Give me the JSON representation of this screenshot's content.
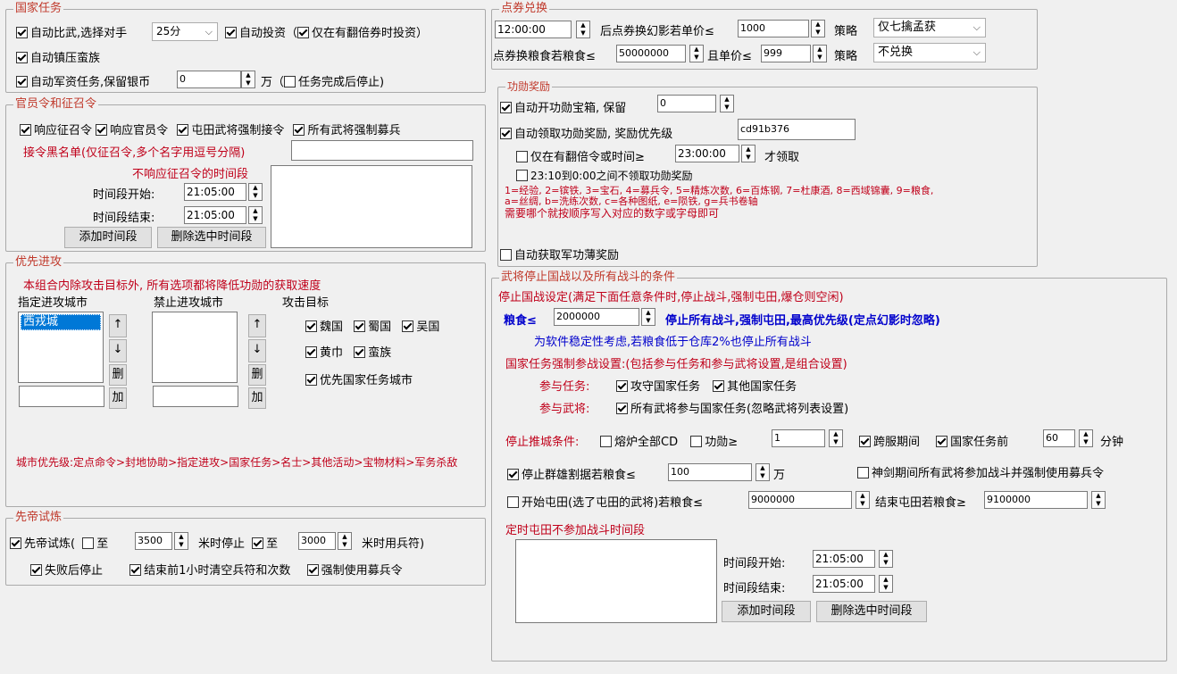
{
  "national_tasks": {
    "title": "国家任务",
    "auto_duel": "自动比武,选择对手",
    "opponent": "25分",
    "auto_invest": "自动投资（",
    "invest_only_double": "仅在有翻倍券时投资",
    "invest_close": "）",
    "auto_suppress": "自动镇压蛮族",
    "auto_military": "自动军资任务,保留银币",
    "silver_value": "0",
    "unit_wan": "万（",
    "stop_after_task": "任务完成后停止)"
  },
  "coupon_exchange": {
    "title": "点券兑换",
    "time_value": "12:00:00",
    "exchange_phantom": "后点券换幻影若单价≤",
    "phantom_price": "1000",
    "strategy_label": "策略",
    "strategy1": "仅七擒孟获",
    "exchange_food": "点券换粮食若粮食≤",
    "food_value": "50000000",
    "and_price": "且单价≤",
    "food_price": "999",
    "strategy2": "不兑换"
  },
  "officer_orders": {
    "title": "官员令和征召令",
    "respond_conscript": "响应征召令",
    "respond_officer": "响应官员令",
    "farm_force": "屯田武将强制接令",
    "all_force_recruit": "所有武将强制募兵",
    "blacklist_label": "接令黑名单(仅征召令,多个名字用逗号分隔)",
    "no_respond_period": "不响应征召令的时间段",
    "period_start_label": "时间段开始:",
    "period_start": "21:05:00",
    "period_end_label": "时间段结束:",
    "period_end": "21:05:00",
    "add_period": "添加时间段",
    "delete_period": "删除选中时间段"
  },
  "priority_attack": {
    "title": "优先进攻",
    "note": "本组合内除攻击目标外, 所有选项都将降低功勋的获取速度",
    "assigned_label": "指定进攻城市",
    "forbidden_label": "禁止进攻城市",
    "target_label": "攻击目标",
    "assigned_city": "西戎城",
    "up": "↑",
    "down": "↓",
    "delete": "删",
    "add": "加",
    "wei": "魏国",
    "shu": "蜀国",
    "wu": "吴国",
    "huangjin": "黄巾",
    "manzu": "蛮族",
    "priority_national": "优先国家任务城市",
    "city_priority": "城市优先级:定点命令>封地协助>指定进攻>国家任务>名士>其他活动>宝物材料>军务杀敌"
  },
  "merit_rewards": {
    "title": "功勋奖励",
    "auto_open_chest": "自动开功勋宝箱, 保留",
    "keep_value": "0",
    "auto_claim": "自动领取功勋奖励, 奖励优先级",
    "priority_value": "cd91b376",
    "only_double": "仅在有翻倍令或时间≥",
    "claim_time": "23:00:00",
    "claim_suffix": "才领取",
    "no_claim_range": "23:10到0:00之间不领取功勋奖励",
    "legend1": "1=经验, 2=镔铁, 3=宝石, 4=募兵令, 5=精炼次数, 6=百炼钢, 7=杜康酒, 8=西域锦囊, 9=粮食,",
    "legend2": "a=丝绸, b=洗练次数, c=各种图纸, e=陨铁, g=兵书卷轴",
    "legend3": "需要哪个就按顺序写入对应的数字或字母即可",
    "auto_military_book": "自动获取军功薄奖励"
  },
  "stop_conditions": {
    "title": "武将停止国战以及所有战斗的条件",
    "stop_setting": "停止国战设定(满足下面任意条件时,停止战斗,强制屯田,爆仓则空闲)",
    "food_label": "粮食≤",
    "food_value": "2000000",
    "food_desc": "停止所有战斗,强制屯田,最高优先级(定点幻影时忽略)",
    "stability_note": "为软件稳定性考虑,若粮食低于仓库2%也停止所有战斗",
    "national_force": "国家任务强制参战设置:(包括参与任务和参与武将设置,是组合设置)",
    "join_task_label": "参与任务:",
    "attack_defend": "攻守国家任务",
    "other_national": "其他国家任务",
    "join_general_label": "参与武将:",
    "all_generals": "所有武将参与国家任务(忽略武将列表设置)",
    "push_stop_label": "停止推城条件:",
    "furnace_cd": "熔炉全部CD",
    "merit_ge": "功勋≥",
    "merit_value": "1",
    "cross_server": "跨服期间",
    "before_national": "国家任务前",
    "before_value": "60",
    "minutes": "分钟",
    "stop_chaos": "停止群雄割据若粮食≤",
    "chaos_value": "100",
    "wan": "万",
    "divine_sword": "神剑期间所有武将参加战斗并强制使用募兵令",
    "start_farm": "开始屯田(选了屯田的武将)若粮食≤",
    "start_farm_value": "9000000",
    "end_farm": "结束屯田若粮食≥",
    "end_farm_value": "9100000",
    "timed_farm": "定时屯田不参加战斗时间段",
    "period_start_label": "时间段开始:",
    "period_start": "21:05:00",
    "period_end_label": "时间段结束:",
    "period_end": "21:05:00",
    "add_period": "添加时间段",
    "delete_period": "删除选中时间段"
  },
  "emperor_trial": {
    "title": "先帝试炼",
    "trial": "先帝试炼(",
    "to1": "至",
    "value1": "3500",
    "stop_at": "米时停止",
    "to2": "至",
    "value2": "3000",
    "use_symbol": "米时用兵符)",
    "stop_on_fail": "失败后停止",
    "clear_before_end": "结束前1小时清空兵符和次数",
    "force_recruit": "强制使用募兵令"
  }
}
